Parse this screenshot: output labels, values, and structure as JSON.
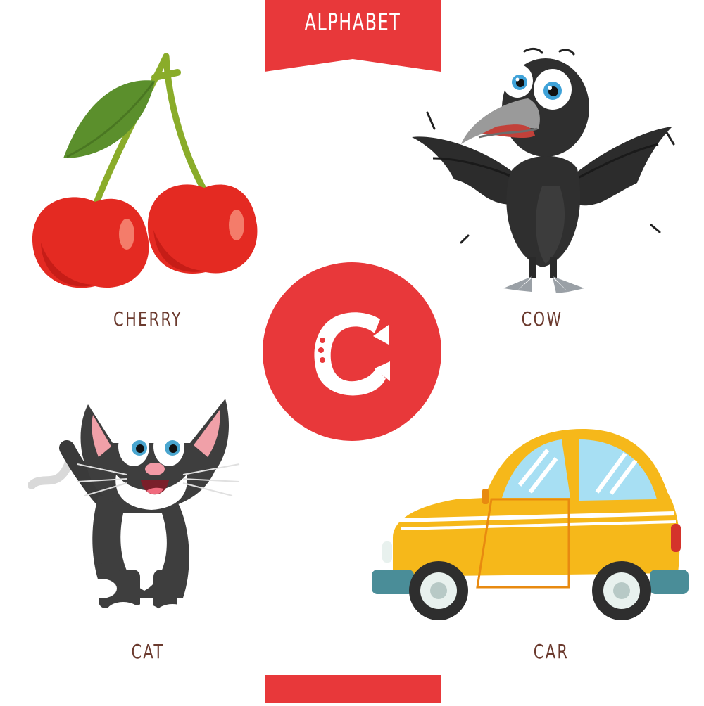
{
  "header": {
    "title": "ALPHABET",
    "color": "#e8383a"
  },
  "letter": {
    "glyph": "C"
  },
  "items": [
    {
      "label": "CHERRY",
      "icon": "cherry-icon"
    },
    {
      "label": "COW",
      "icon": "crow-icon"
    },
    {
      "label": "CAT",
      "icon": "cat-icon"
    },
    {
      "label": "CAR",
      "icon": "car-icon"
    }
  ],
  "colors": {
    "accent": "#e8383a",
    "label_text": "#6b3a2e",
    "cherry": "#e42a22",
    "car": "#f6b81a"
  }
}
